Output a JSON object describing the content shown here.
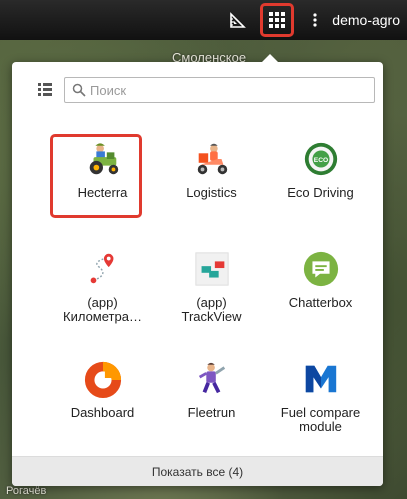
{
  "user": {
    "name": "demo-agro"
  },
  "map": {
    "top_label": "Смоленское",
    "bottom_label": "Рогачёв"
  },
  "search": {
    "placeholder": "Поиск"
  },
  "apps": [
    {
      "label": "Hecterra",
      "icon": "tractor-icon"
    },
    {
      "label": "Logistics",
      "icon": "delivery-scooter-icon"
    },
    {
      "label": "Eco Driving",
      "icon": "eco-steering-wheel-icon"
    },
    {
      "label": "(app)\nКилометра…",
      "icon": "route-pin-icon"
    },
    {
      "label": "(app)\nTrackView",
      "icon": "trackview-icon"
    },
    {
      "label": "Chatterbox",
      "icon": "chat-bubble-icon"
    },
    {
      "label": "Dashboard",
      "icon": "donut-chart-icon"
    },
    {
      "label": "Fleetrun",
      "icon": "mechanic-icon"
    },
    {
      "label": "Fuel compare\nmodule",
      "icon": "fuel-compare-m-icon"
    }
  ],
  "footer": {
    "show_all_label": "Показать все (4)"
  },
  "colors": {
    "highlight": "#e03a2e",
    "topbar": "#1a1a1a"
  }
}
